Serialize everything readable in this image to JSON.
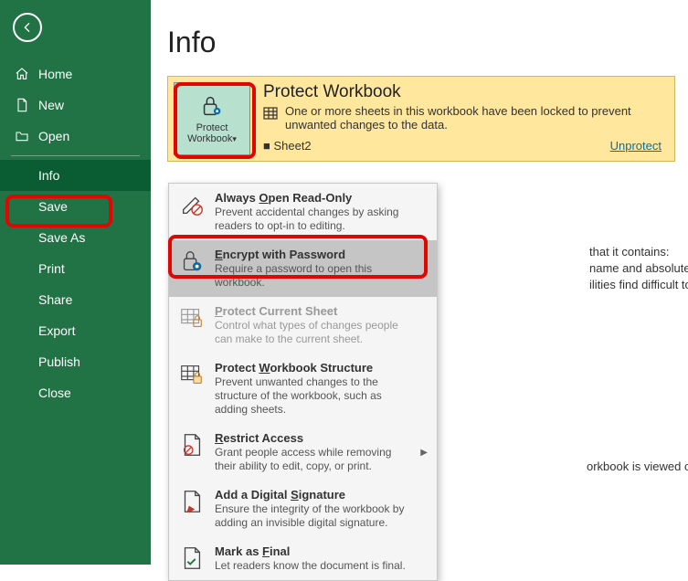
{
  "sidebar": {
    "items": [
      {
        "label": "Home"
      },
      {
        "label": "New"
      },
      {
        "label": "Open"
      },
      {
        "label": "Info"
      },
      {
        "label": "Save"
      },
      {
        "label": "Save As"
      },
      {
        "label": "Print"
      },
      {
        "label": "Share"
      },
      {
        "label": "Export"
      },
      {
        "label": "Publish"
      },
      {
        "label": "Close"
      }
    ]
  },
  "page": {
    "title": "Info"
  },
  "panel": {
    "button_label_line1": "Protect",
    "button_label_line2": "Workbook",
    "title": "Protect Workbook",
    "desc": "One or more sheets in this workbook have been locked to prevent unwanted changes to the data.",
    "sheet_bullet": "■   Sheet2",
    "unprotect_label": "Unprotect"
  },
  "bg_text": {
    "a": "that it contains:",
    "b": "name and absolute path",
    "c": "ilities find difficult to read",
    "d": "orkbook is viewed on the Web."
  },
  "dropdown": {
    "items": [
      {
        "title_pre": "Always ",
        "title_u": "O",
        "title_post": "pen Read-Only",
        "desc": "Prevent accidental changes by asking readers to opt-in to editing."
      },
      {
        "title_pre": "",
        "title_u": "E",
        "title_post": "ncrypt with Password",
        "desc": "Require a password to open this workbook."
      },
      {
        "title_pre": "",
        "title_u": "P",
        "title_post": "rotect Current Sheet",
        "desc": "Control what types of changes people can make to the current sheet."
      },
      {
        "title_pre": "Protect ",
        "title_u": "W",
        "title_post": "orkbook Structure",
        "desc": "Prevent unwanted changes to the structure of the workbook, such as adding sheets."
      },
      {
        "title_pre": "",
        "title_u": "R",
        "title_post": "estrict Access",
        "desc": "Grant people access while removing their ability to edit, copy, or print."
      },
      {
        "title_pre": "Add a Digital ",
        "title_u": "S",
        "title_post": "ignature",
        "desc": "Ensure the integrity of the workbook by adding an invisible digital signature."
      },
      {
        "title_pre": "Mark as ",
        "title_u": "F",
        "title_post": "inal",
        "desc": "Let readers know the document is final."
      }
    ]
  }
}
